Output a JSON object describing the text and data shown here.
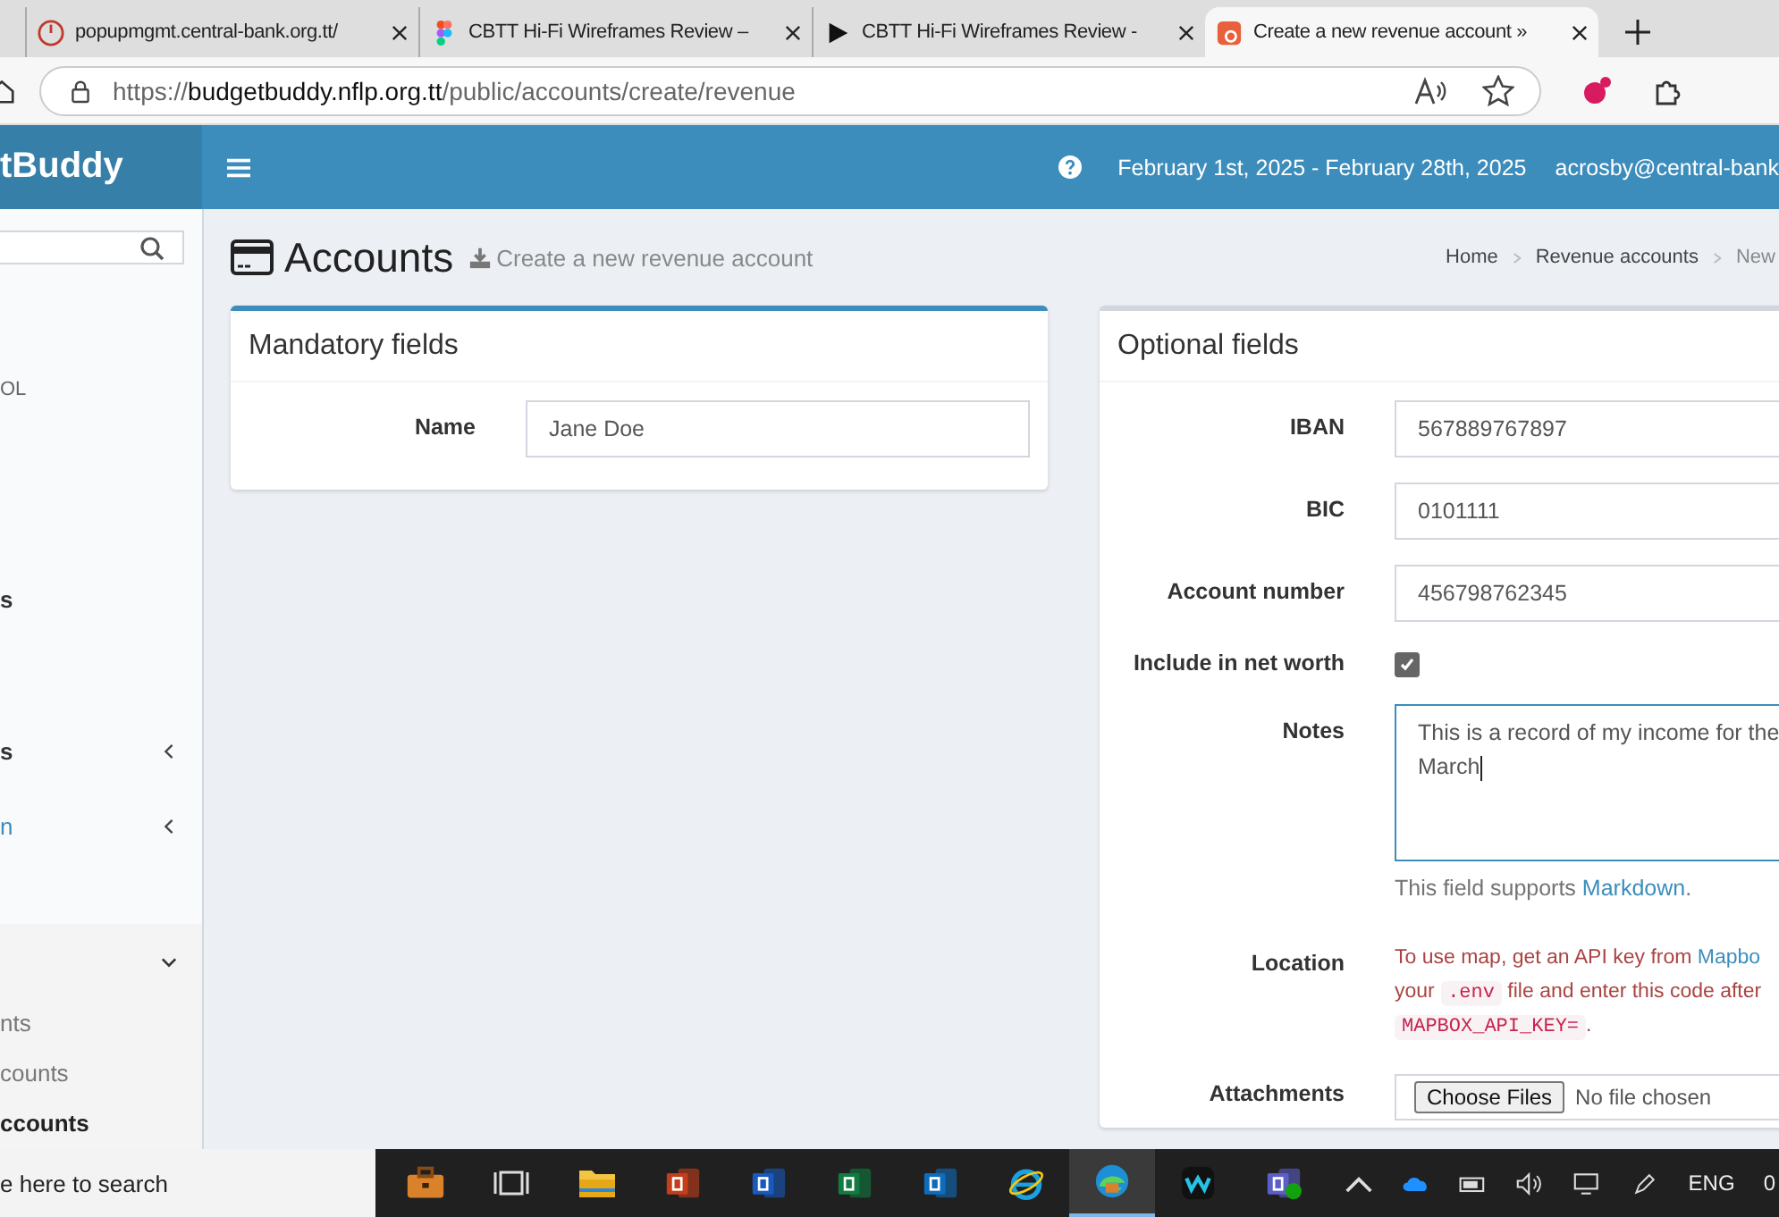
{
  "browser": {
    "tabs": [
      {
        "title": "popupmgmt.central-bank.org.tt/",
        "selected": false
      },
      {
        "title": "CBTT Hi-Fi Wireframes Review –",
        "selected": false
      },
      {
        "title": "CBTT Hi-Fi Wireframes Review -",
        "selected": false
      },
      {
        "title": "Create a new revenue account »",
        "selected": true
      }
    ],
    "url": {
      "scheme": "https://",
      "host": "budgetbuddy.nflp.org.tt",
      "path": "/public/accounts/create/revenue"
    }
  },
  "header": {
    "brand": "tBuddy",
    "date_range": "February 1st, 2025 - February 28th, 2025",
    "user": "acrosby@central-bank"
  },
  "sidebar": {
    "items": [
      {
        "kind": "text",
        "label": "OL"
      },
      {
        "kind": "heading",
        "label": "s"
      },
      {
        "kind": "group",
        "label": "s",
        "expanded": false,
        "link": false
      },
      {
        "kind": "group",
        "label": "n",
        "expanded": false,
        "link": true
      },
      {
        "kind": "group",
        "expanded": true,
        "children": [
          {
            "label": "nts",
            "selected": false
          },
          {
            "label": "counts",
            "selected": false
          },
          {
            "label": "ccounts",
            "selected": true
          }
        ]
      }
    ]
  },
  "page": {
    "title": "Accounts",
    "subtitle": "Create a new revenue account",
    "breadcrumb": [
      "Home",
      "Revenue accounts",
      "New"
    ]
  },
  "mandatory": {
    "title": "Mandatory fields",
    "fields": [
      {
        "kind": "text",
        "label": "Name",
        "value": "Jane Doe"
      }
    ]
  },
  "optional": {
    "title": "Optional fields",
    "fields": [
      {
        "kind": "text",
        "label": "IBAN",
        "value": "567889767897"
      },
      {
        "kind": "text",
        "label": "BIC",
        "value": "0101111"
      },
      {
        "kind": "text",
        "label": "Account number",
        "value": "456798762345"
      },
      {
        "kind": "checkbox",
        "label": "Include in net worth",
        "checked": true
      },
      {
        "kind": "textarea",
        "label": "Notes",
        "value": "This is a record of my income for the\nMarch",
        "help": [
          {
            "kind": "text",
            "text": "This field supports "
          },
          {
            "kind": "link",
            "text": "Markdown"
          },
          {
            "kind": "text",
            "text": "."
          }
        ]
      },
      {
        "kind": "note",
        "label": "Location",
        "lines": [
          [
            {
              "kind": "text",
              "text": "To use map, get an API key from "
            },
            {
              "kind": "link",
              "text": "Mapbo"
            }
          ],
          [
            {
              "kind": "text",
              "text": "your "
            },
            {
              "kind": "code",
              "text": ".env"
            },
            {
              "kind": "text",
              "text": " file and enter this code after"
            }
          ],
          [
            {
              "kind": "code",
              "text": "MAPBOX_API_KEY="
            },
            {
              "kind": "text",
              "text": "."
            }
          ]
        ]
      },
      {
        "kind": "file",
        "label": "Attachments",
        "button": "Choose Files",
        "status": "No file chosen"
      }
    ]
  },
  "taskbar": {
    "search": "e here to search",
    "apps": [
      {
        "selected": false
      },
      {
        "selected": false
      },
      {
        "selected": false
      },
      {
        "selected": false
      },
      {
        "selected": false
      },
      {
        "selected": false
      },
      {
        "selected": false
      },
      {
        "selected": false
      },
      {
        "selected": true
      },
      {
        "selected": false
      },
      {
        "selected": false
      }
    ],
    "language": "ENG",
    "clock": "0"
  }
}
